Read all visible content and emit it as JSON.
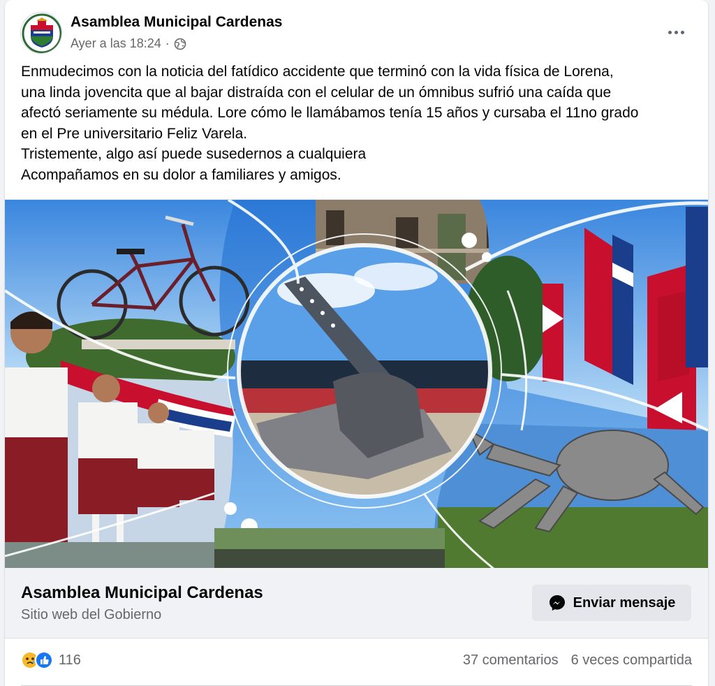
{
  "post": {
    "page_name": "Asamblea Municipal Cardenas",
    "timestamp": "Ayer a las 18:24",
    "separator": "·",
    "audience_icon": "globe-icon",
    "more_icon": "more-horizontal-icon",
    "text_lines": [
      "Enmudecimos con la noticia del fatídico accidente que terminó con la vida física de Lorena,",
      "una linda jovencita que al bajar distraída con el celular de un ómnibus sufrió una  caída que",
      "afectó seriamente su médula. Lore cómo le llamábamos tenía 15 años y cursaba el 11no grado",
      "en el Pre universitario Feliz Varela.",
      "Tristemente, algo así puede susedernos a cualquiera",
      "Acompañamos en su dolor a familiares y amigos."
    ]
  },
  "preview": {
    "title": "Asamblea Municipal Cardenas",
    "subtitle": "Sitio web del Gobierno",
    "button_label": "Enviar mensaje",
    "button_icon": "messenger-icon"
  },
  "footer": {
    "reaction_icons": [
      "sad-reaction-icon",
      "like-reaction-icon"
    ],
    "reaction_count": "116",
    "comments": "37 comentarios",
    "shares": "6 veces compartida"
  },
  "colors": {
    "facebook_blue": "#1877f2",
    "text_secondary": "#65676b",
    "preview_bg": "#f0f2f5",
    "button_bg": "#e4e6eb"
  }
}
